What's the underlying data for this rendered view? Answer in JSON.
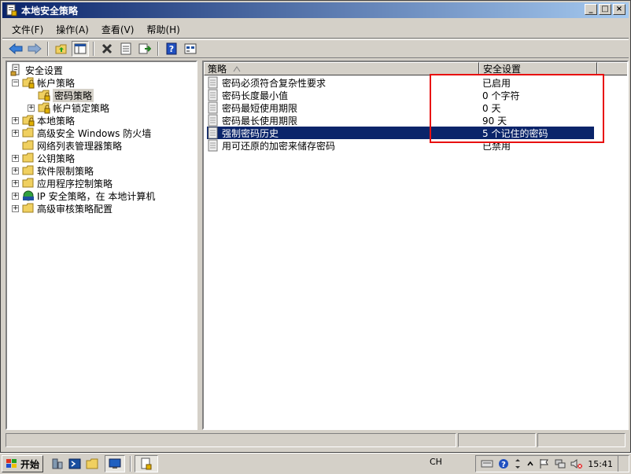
{
  "window": {
    "title": "本地安全策略"
  },
  "menu": [
    {
      "label": "文件(F)"
    },
    {
      "label": "操作(A)"
    },
    {
      "label": "查看(V)"
    },
    {
      "label": "帮助(H)"
    }
  ],
  "tree": [
    {
      "label": "安全设置",
      "level": 0,
      "expander": "",
      "icon": "security-settings-icon"
    },
    {
      "label": "帐户策略",
      "level": 1,
      "expander": "−",
      "icon": "folder-lock-icon"
    },
    {
      "label": "密码策略",
      "level": 2,
      "expander": "",
      "icon": "folder-lock-icon",
      "selected": true
    },
    {
      "label": "帐户锁定策略",
      "level": 2,
      "expander": "+",
      "icon": "folder-lock-icon"
    },
    {
      "label": "本地策略",
      "level": 1,
      "expander": "+",
      "icon": "folder-lock-icon"
    },
    {
      "label": "高级安全 Windows 防火墙",
      "level": 1,
      "expander": "+",
      "icon": "folder-icon"
    },
    {
      "label": "网络列表管理器策略",
      "level": 1,
      "expander": "",
      "icon": "folder-icon"
    },
    {
      "label": "公钥策略",
      "level": 1,
      "expander": "+",
      "icon": "folder-icon"
    },
    {
      "label": "软件限制策略",
      "level": 1,
      "expander": "+",
      "icon": "folder-icon"
    },
    {
      "label": "应用程序控制策略",
      "level": 1,
      "expander": "+",
      "icon": "folder-icon"
    },
    {
      "label": "IP 安全策略，在 本地计算机",
      "level": 1,
      "expander": "+",
      "icon": "ip-security-icon"
    },
    {
      "label": "高级审核策略配置",
      "level": 1,
      "expander": "+",
      "icon": "folder-icon"
    }
  ],
  "list": {
    "columns": [
      {
        "label": "策略"
      },
      {
        "label": "安全设置"
      }
    ],
    "rows": [
      {
        "policy": "密码必须符合复杂性要求",
        "setting": "已启用",
        "selected": false
      },
      {
        "policy": "密码长度最小值",
        "setting": "0 个字符",
        "selected": false
      },
      {
        "policy": "密码最短使用期限",
        "setting": "0 天",
        "selected": false
      },
      {
        "policy": "密码最长使用期限",
        "setting": "90 天",
        "selected": false
      },
      {
        "policy": "强制密码历史",
        "setting": "5 个记住的密码",
        "selected": true
      },
      {
        "policy": "用可还原的加密来储存密码",
        "setting": "已禁用",
        "selected": false
      }
    ]
  },
  "taskbar": {
    "start_label": "开始",
    "lang": "CH",
    "clock": "15:41"
  },
  "colors": {
    "selection": "#0a246a",
    "highlight_box": "#e81010",
    "title_gradient_start": "#0a246a",
    "title_gradient_end": "#a6caf0"
  }
}
